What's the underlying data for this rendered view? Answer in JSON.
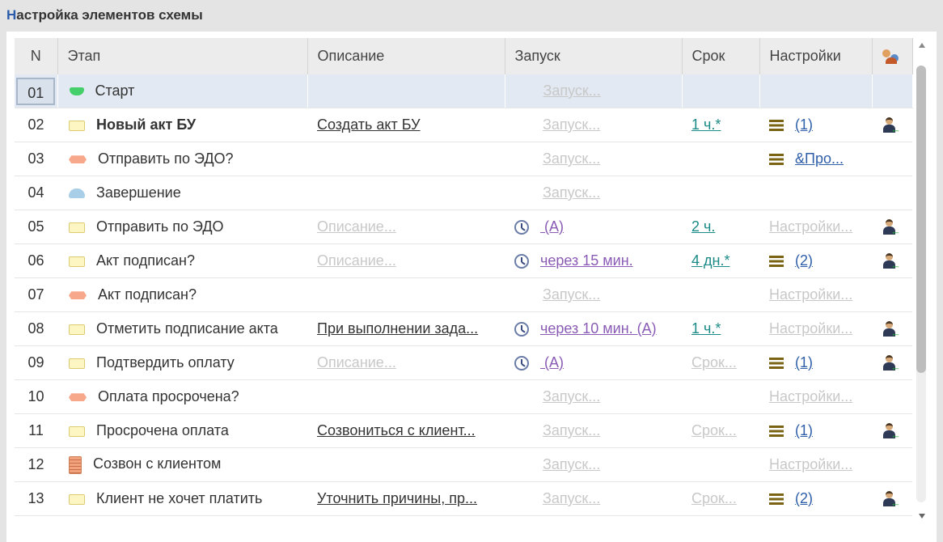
{
  "title_first": "Н",
  "title_rest": "астройка элементов схемы",
  "columns": {
    "n": "N",
    "stage": "Этап",
    "desc": "Описание",
    "launch": "Запуск",
    "term": "Срок",
    "settings": "Настройки"
  },
  "header_icon": "users-icon",
  "rows": [
    {
      "n": "01",
      "icon": "start-icon",
      "stage": "Старт",
      "bold": false,
      "desc": "",
      "desc_style": "",
      "launch": "Запуск...",
      "launch_style": "faint",
      "clock": false,
      "term": "",
      "term_style": "",
      "menu": false,
      "settings": "",
      "settings_style": "",
      "user": false
    },
    {
      "n": "02",
      "icon": "task-icon",
      "stage": "Новый акт БУ",
      "bold": true,
      "desc": "Создать акт БУ",
      "desc_style": "ulink",
      "launch": "Запуск...",
      "launch_style": "faint",
      "clock": false,
      "term": "1 ч.*",
      "term_style": "teal",
      "menu": true,
      "settings": "(1)",
      "settings_style": "blue",
      "user": true
    },
    {
      "n": "03",
      "icon": "condition-icon",
      "stage": "Отправить по ЭДО?",
      "bold": false,
      "desc": "",
      "desc_style": "",
      "launch": "Запуск...",
      "launch_style": "faint",
      "clock": false,
      "term": "",
      "term_style": "",
      "menu": true,
      "settings": "&Про...",
      "settings_style": "blue",
      "user": false
    },
    {
      "n": "04",
      "icon": "end-icon",
      "stage": "Завершение",
      "bold": false,
      "desc": "",
      "desc_style": "",
      "launch": "Запуск...",
      "launch_style": "faint",
      "clock": false,
      "term": "",
      "term_style": "",
      "menu": false,
      "settings": "",
      "settings_style": "",
      "user": false
    },
    {
      "n": "05",
      "icon": "task-icon",
      "stage": "Отправить по ЭДО",
      "bold": false,
      "desc": "Описание...",
      "desc_style": "faint",
      "launch": " (А)",
      "launch_style": "purple",
      "clock": true,
      "term": "2 ч.",
      "term_style": "teal",
      "menu": false,
      "settings": "Настройки...",
      "settings_style": "faint",
      "user": true
    },
    {
      "n": "06",
      "icon": "task-icon",
      "stage": "Акт подписан?",
      "bold": false,
      "desc": "Описание...",
      "desc_style": "faint",
      "launch": "через 15 мин.",
      "launch_style": "purple",
      "clock": true,
      "term": "4 дн.*",
      "term_style": "teal",
      "menu": true,
      "settings": "(2)",
      "settings_style": "blue",
      "user": true
    },
    {
      "n": "07",
      "icon": "condition-icon",
      "stage": "Акт подписан?",
      "bold": false,
      "desc": "",
      "desc_style": "",
      "launch": "Запуск...",
      "launch_style": "faint",
      "clock": false,
      "term": "",
      "term_style": "",
      "menu": false,
      "settings": "Настройки...",
      "settings_style": "faint",
      "user": false
    },
    {
      "n": "08",
      "icon": "task-icon",
      "stage": "Отметить подписание акта",
      "bold": false,
      "desc": "При выполнении зада...",
      "desc_style": "ulink",
      "launch": "через 10 мин. (А)",
      "launch_style": "purple",
      "clock": true,
      "term": "1 ч.*",
      "term_style": "teal",
      "menu": false,
      "settings": "Настройки...",
      "settings_style": "faint",
      "user": true
    },
    {
      "n": "09",
      "icon": "task-icon",
      "stage": "Подтвердить оплату",
      "bold": false,
      "desc": "Описание...",
      "desc_style": "faint",
      "launch": " (А)",
      "launch_style": "purple",
      "clock": true,
      "term": "Срок...",
      "term_style": "faint",
      "menu": true,
      "settings": "(1)",
      "settings_style": "blue",
      "user": true
    },
    {
      "n": "10",
      "icon": "condition-icon",
      "stage": "Оплата просрочена?",
      "bold": false,
      "desc": "",
      "desc_style": "",
      "launch": "Запуск...",
      "launch_style": "faint",
      "clock": false,
      "term": "",
      "term_style": "",
      "menu": false,
      "settings": "Настройки...",
      "settings_style": "faint",
      "user": false
    },
    {
      "n": "11",
      "icon": "task-icon",
      "stage": "Просрочена оплата",
      "bold": false,
      "desc": "Созвониться с клиент...",
      "desc_style": "ulink",
      "launch": "Запуск...",
      "launch_style": "faint",
      "clock": false,
      "term": "Срок...",
      "term_style": "faint",
      "menu": true,
      "settings": "(1)",
      "settings_style": "blue",
      "user": true
    },
    {
      "n": "12",
      "icon": "call-icon",
      "stage": "Созвон с клиентом",
      "bold": false,
      "desc": "",
      "desc_style": "",
      "launch": "Запуск...",
      "launch_style": "faint",
      "clock": false,
      "term": "",
      "term_style": "",
      "menu": false,
      "settings": "Настройки...",
      "settings_style": "faint",
      "user": false
    },
    {
      "n": "13",
      "icon": "task-icon",
      "stage": "Клиент не хочет платить",
      "bold": false,
      "desc": "Уточнить причины, пр...",
      "desc_style": "ulink",
      "launch": "Запуск...",
      "launch_style": "faint",
      "clock": false,
      "term": "Срок...",
      "term_style": "faint",
      "menu": true,
      "settings": "(2)",
      "settings_style": "blue",
      "user": true
    }
  ]
}
